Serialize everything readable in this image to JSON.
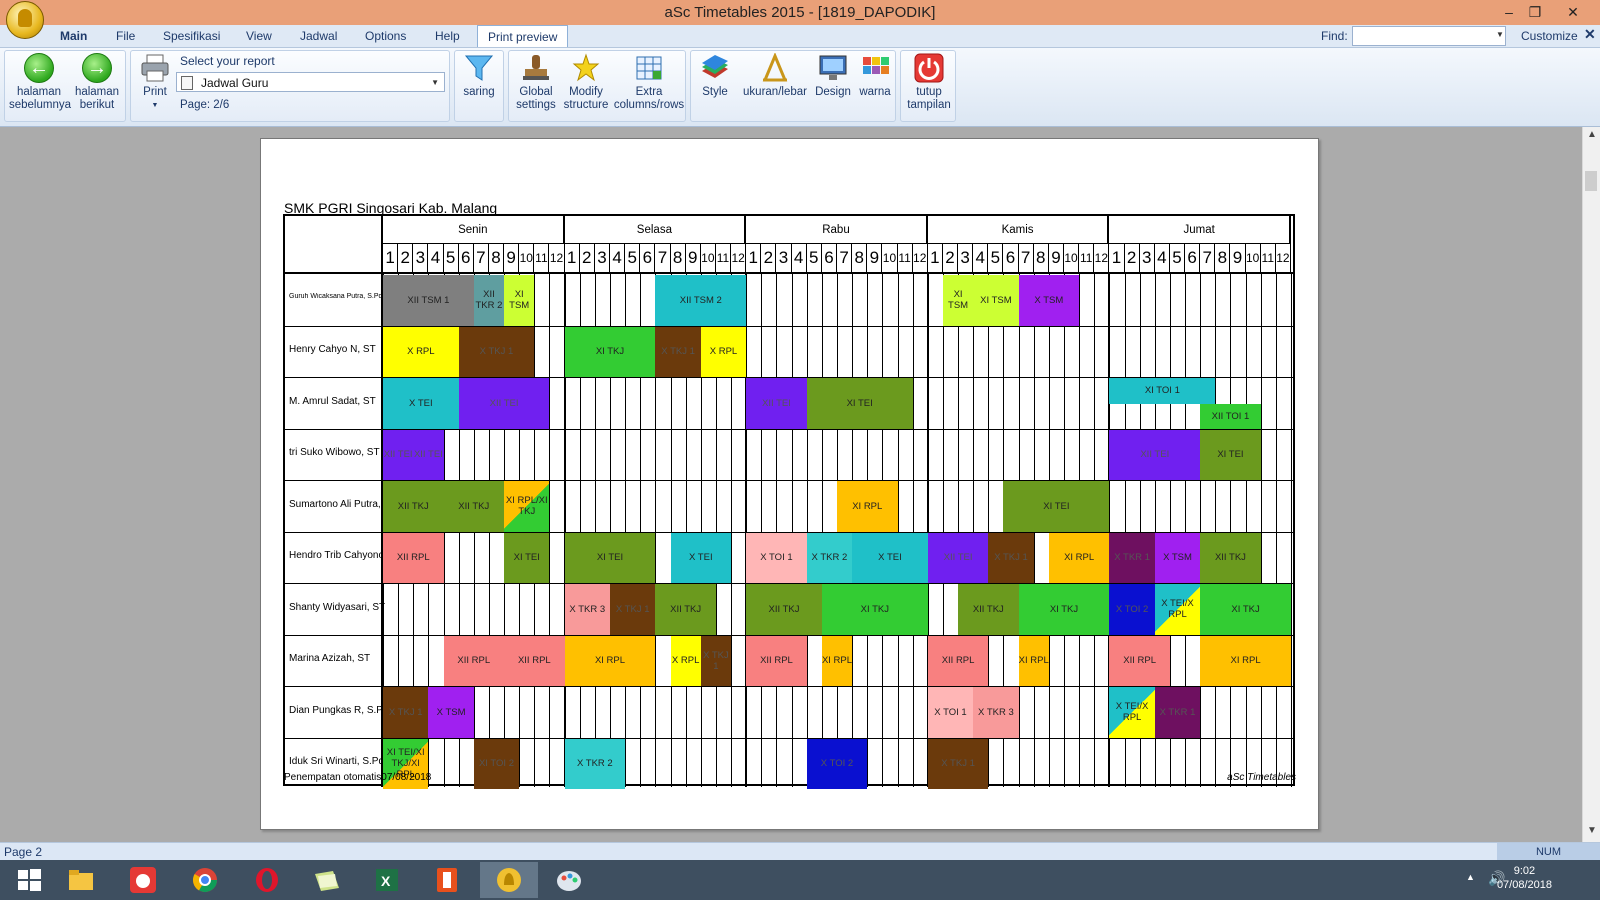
{
  "window": {
    "title": "aSc Timetables 2015  - [1819_DAPODIK]",
    "minimize": "–",
    "restore": "❐",
    "close": "✕"
  },
  "menu": {
    "items": [
      "Main",
      "File",
      "Spesifikasi",
      "View",
      "Jadwal",
      "Options",
      "Help"
    ],
    "active_tab": "Print preview",
    "find_label": "Find:",
    "find_value": "",
    "customize": "Customize",
    "close_glyph": "✕"
  },
  "ribbon": {
    "prev_label_1": "halaman",
    "prev_label_2": "sebelumnya",
    "next_label_1": "halaman",
    "next_label_2": "berikut",
    "print_label": "Print",
    "select_label": "Select your report",
    "report_value": "Jadwal Guru",
    "page_indicator": "Page: 2/6",
    "filter_label": "saring",
    "global_1": "Global",
    "global_2": "settings",
    "modify_1": "Modify",
    "modify_2": "structure",
    "extra_1": "Extra",
    "extra_2": "columns/rows",
    "style_label": "Style",
    "size_label": "ukuran/lebar",
    "design_label": "Design",
    "color_label": "warna",
    "close_1": "tutup",
    "close_2": "tampilan"
  },
  "timetable": {
    "school": "SMK PGRI Singosari Kab. Malang",
    "days": [
      "Senin",
      "Selasa",
      "Rabu",
      "Kamis",
      "Jumat"
    ],
    "periods": [
      "1",
      "2",
      "3",
      "4",
      "5",
      "6",
      "7",
      "8",
      "9",
      "10",
      "11",
      "12"
    ],
    "teachers": [
      "Guruh Wicaksana Putra, S.Pd",
      "Henry Cahyo N, ST",
      "M. Amrul Sadat, ST",
      "tri Suko Wibowo, ST",
      "Sumartono Ali Putra, ST",
      "Hendro Trib Cahyono, ST",
      "Shanty Widyasari, ST",
      "Marina Azizah, ST",
      "Dian Pungkas R, S.Pd",
      "Iduk Sri Winarti, S.Pd"
    ],
    "lessons": [
      {
        "row": 0,
        "day": 0,
        "p": 1,
        "span": 6,
        "label": "XII TSM 1",
        "color": "#7f7f7f"
      },
      {
        "row": 0,
        "day": 0,
        "p": 7,
        "span": 2,
        "label": "XII TKR 2",
        "color": "#5f9ea0"
      },
      {
        "row": 0,
        "day": 0,
        "p": 9,
        "span": 2,
        "label": "XI TSM",
        "color": "#ccff33"
      },
      {
        "row": 0,
        "day": 1,
        "p": 7,
        "span": 6,
        "label": "XII TSM 2",
        "color": "#1fc0c8"
      },
      {
        "row": 0,
        "day": 3,
        "p": 2,
        "span": 2,
        "label": "XI TSM",
        "color": "#ccff33"
      },
      {
        "row": 0,
        "day": 3,
        "p": 4,
        "span": 3,
        "label": "XI TSM",
        "color": "#ccff33"
      },
      {
        "row": 0,
        "day": 3,
        "p": 7,
        "span": 4,
        "label": "X TSM",
        "color": "#a020f0"
      },
      {
        "row": 1,
        "day": 0,
        "p": 1,
        "span": 5,
        "label": "X RPL",
        "color": "#ffff00"
      },
      {
        "row": 1,
        "day": 0,
        "p": 6,
        "span": 5,
        "label": "X TKJ 1",
        "color": "#6b3a0c"
      },
      {
        "row": 1,
        "day": 1,
        "p": 1,
        "span": 6,
        "label": "XI TKJ",
        "color": "#33cc33"
      },
      {
        "row": 1,
        "day": 1,
        "p": 7,
        "span": 3,
        "label": "X TKJ 1",
        "color": "#6b3a0c"
      },
      {
        "row": 1,
        "day": 1,
        "p": 10,
        "span": 3,
        "label": "X RPL",
        "color": "#ffff00"
      },
      {
        "row": 2,
        "day": 0,
        "p": 1,
        "span": 5,
        "label": "X TEI",
        "color": "#1fc0c8"
      },
      {
        "row": 2,
        "day": 0,
        "p": 6,
        "span": 6,
        "label": "XII TEI",
        "color": "#7020f0"
      },
      {
        "row": 2,
        "day": 2,
        "p": 1,
        "span": 4,
        "label": "XII TEI",
        "color": "#7020f0"
      },
      {
        "row": 2,
        "day": 2,
        "p": 5,
        "span": 7,
        "label": "XI TEI",
        "color": "#6b9a1e"
      },
      {
        "row": 2,
        "day": 4,
        "p": 1,
        "span": 7,
        "label": "XI TOI 1",
        "color": "#1fc0c8",
        "half": "top"
      },
      {
        "row": 2,
        "day": 4,
        "p": 7,
        "span": 4,
        "label": "XII TOI 1",
        "color": "#33cc33",
        "half": "bottom"
      },
      {
        "row": 3,
        "day": 0,
        "p": 1,
        "span": 2,
        "label": "XII TEI",
        "color": "#7020f0"
      },
      {
        "row": 3,
        "day": 0,
        "p": 3,
        "span": 2,
        "label": "XII TEI",
        "color": "#7020f0"
      },
      {
        "row": 3,
        "day": 4,
        "p": 1,
        "span": 6,
        "label": "XII TEI",
        "color": "#7020f0"
      },
      {
        "row": 3,
        "day": 4,
        "p": 7,
        "span": 4,
        "label": "XI TEI",
        "color": "#6b9a1e"
      },
      {
        "row": 4,
        "day": 0,
        "p": 1,
        "span": 4,
        "label": "XII TKJ",
        "color": "#6b9a1e"
      },
      {
        "row": 4,
        "day": 0,
        "p": 5,
        "span": 4,
        "label": "XII TKJ",
        "color": "#6b9a1e"
      },
      {
        "row": 4,
        "day": 0,
        "p": 9,
        "span": 3,
        "label": "XI RPL/XI TKJ",
        "color": "#ffc000",
        "color2": "#33cc33"
      },
      {
        "row": 4,
        "day": 2,
        "p": 7,
        "span": 4,
        "label": "XI RPL",
        "color": "#ffc000"
      },
      {
        "row": 4,
        "day": 3,
        "p": 6,
        "span": 7,
        "label": "XI TEI",
        "color": "#6b9a1e"
      },
      {
        "row": 5,
        "day": 0,
        "p": 1,
        "span": 4,
        "label": "XII RPL",
        "color": "#f88080"
      },
      {
        "row": 5,
        "day": 0,
        "p": 9,
        "span": 3,
        "label": "XI TEI",
        "color": "#6b9a1e"
      },
      {
        "row": 5,
        "day": 1,
        "p": 1,
        "span": 6,
        "label": "XI TEI",
        "color": "#6b9a1e"
      },
      {
        "row": 5,
        "day": 1,
        "p": 8,
        "span": 4,
        "label": "X TEI",
        "color": "#1fc0c8"
      },
      {
        "row": 5,
        "day": 2,
        "p": 1,
        "span": 4,
        "label": "X TOI 1",
        "color": "#ffb6b6"
      },
      {
        "row": 5,
        "day": 2,
        "p": 5,
        "span": 3,
        "label": "X TKR 2",
        "color": "#33cccc"
      },
      {
        "row": 5,
        "day": 2,
        "p": 8,
        "span": 5,
        "label": "X TEI",
        "color": "#1fc0c8"
      },
      {
        "row": 5,
        "day": 3,
        "p": 1,
        "span": 4,
        "label": "XII TEI",
        "color": "#7020f0"
      },
      {
        "row": 5,
        "day": 3,
        "p": 5,
        "span": 3,
        "label": "X TKJ 1",
        "color": "#6b3a0c"
      },
      {
        "row": 5,
        "day": 3,
        "p": 9,
        "span": 4,
        "label": "XI RPL",
        "color": "#ffc000"
      },
      {
        "row": 5,
        "day": 4,
        "p": 1,
        "span": 3,
        "label": "X TKR 1",
        "color": "#6e1060"
      },
      {
        "row": 5,
        "day": 4,
        "p": 4,
        "span": 3,
        "label": "X TSM",
        "color": "#a020f0"
      },
      {
        "row": 5,
        "day": 4,
        "p": 7,
        "span": 4,
        "label": "XII TKJ",
        "color": "#6b9a1e"
      },
      {
        "row": 6,
        "day": 1,
        "p": 1,
        "span": 3,
        "label": "X TKR 3",
        "color": "#f89a9a"
      },
      {
        "row": 6,
        "day": 1,
        "p": 4,
        "span": 3,
        "label": "X TKJ 1",
        "color": "#6b3a0c"
      },
      {
        "row": 6,
        "day": 1,
        "p": 7,
        "span": 4,
        "label": "XII TKJ",
        "color": "#6b9a1e"
      },
      {
        "row": 6,
        "day": 2,
        "p": 1,
        "span": 5,
        "label": "XII TKJ",
        "color": "#6b9a1e"
      },
      {
        "row": 6,
        "day": 2,
        "p": 6,
        "span": 7,
        "label": "XI TKJ",
        "color": "#33cc33"
      },
      {
        "row": 6,
        "day": 3,
        "p": 3,
        "span": 4,
        "label": "XII TKJ",
        "color": "#6b9a1e"
      },
      {
        "row": 6,
        "day": 3,
        "p": 7,
        "span": 6,
        "label": "XI TKJ",
        "color": "#33cc33"
      },
      {
        "row": 6,
        "day": 4,
        "p": 1,
        "span": 3,
        "label": "X TOI 2",
        "color": "#0a10d0"
      },
      {
        "row": 6,
        "day": 4,
        "p": 4,
        "span": 3,
        "label": "X TEI/X RPL",
        "color": "#1fc0c8",
        "color2": "#ffff00"
      },
      {
        "row": 6,
        "day": 4,
        "p": 7,
        "span": 6,
        "label": "XI TKJ",
        "color": "#33cc33"
      },
      {
        "row": 7,
        "day": 0,
        "p": 5,
        "span": 4,
        "label": "XII RPL",
        "color": "#f88080"
      },
      {
        "row": 7,
        "day": 0,
        "p": 9,
        "span": 4,
        "label": "XII RPL",
        "color": "#f88080"
      },
      {
        "row": 7,
        "day": 1,
        "p": 1,
        "span": 6,
        "label": "XI RPL",
        "color": "#ffc000"
      },
      {
        "row": 7,
        "day": 1,
        "p": 8,
        "span": 2,
        "label": "X RPL",
        "color": "#ffff00"
      },
      {
        "row": 7,
        "day": 1,
        "p": 10,
        "span": 2,
        "label": "X TKJ 1",
        "color": "#6b3a0c"
      },
      {
        "row": 7,
        "day": 2,
        "p": 1,
        "span": 4,
        "label": "XII RPL",
        "color": "#f88080"
      },
      {
        "row": 7,
        "day": 2,
        "p": 6,
        "span": 2,
        "label": "XI RPL",
        "color": "#ffc000"
      },
      {
        "row": 7,
        "day": 3,
        "p": 1,
        "span": 4,
        "label": "XII RPL",
        "color": "#f88080"
      },
      {
        "row": 7,
        "day": 3,
        "p": 7,
        "span": 2,
        "label": "XI RPL",
        "color": "#ffc000"
      },
      {
        "row": 7,
        "day": 4,
        "p": 1,
        "span": 4,
        "label": "XII RPL",
        "color": "#f88080"
      },
      {
        "row": 7,
        "day": 4,
        "p": 7,
        "span": 6,
        "label": "XI RPL",
        "color": "#ffc000"
      },
      {
        "row": 8,
        "day": 0,
        "p": 1,
        "span": 3,
        "label": "X TKJ 1",
        "color": "#6b3a0c"
      },
      {
        "row": 8,
        "day": 0,
        "p": 4,
        "span": 3,
        "label": "X TSM",
        "color": "#a020f0"
      },
      {
        "row": 8,
        "day": 3,
        "p": 1,
        "span": 3,
        "label": "X TOI 1",
        "color": "#ffb6b6"
      },
      {
        "row": 8,
        "day": 3,
        "p": 4,
        "span": 3,
        "label": "X TKR 3",
        "color": "#f89a9a"
      },
      {
        "row": 8,
        "day": 4,
        "p": 1,
        "span": 3,
        "label": "X TEI/X RPL",
        "color": "#1fc0c8",
        "color2": "#ffff00"
      },
      {
        "row": 8,
        "day": 4,
        "p": 4,
        "span": 3,
        "label": "X TKR 1",
        "color": "#6e1060"
      },
      {
        "row": 9,
        "day": 0,
        "p": 1,
        "span": 3,
        "label": "XI TEI/XI TKJ/XI RPL",
        "color": "#33cc33",
        "color2": "#ffc000"
      },
      {
        "row": 9,
        "day": 0,
        "p": 7,
        "span": 3,
        "label": "XI TOI 2",
        "color": "#6b3a0c"
      },
      {
        "row": 9,
        "day": 1,
        "p": 1,
        "span": 4,
        "label": "X TKR 2",
        "color": "#33cccc"
      },
      {
        "row": 9,
        "day": 2,
        "p": 5,
        "span": 4,
        "label": "X TOI 2",
        "color": "#0a10d0"
      },
      {
        "row": 9,
        "day": 3,
        "p": 1,
        "span": 4,
        "label": "X TKJ 1",
        "color": "#6b3a0c"
      }
    ],
    "footer_left": "Penempatan otomatis07/08/2018",
    "footer_right": "aSc Timetables"
  },
  "status": {
    "page": "Page 2",
    "num": "NUM"
  },
  "taskbar": {
    "apps": [
      "start",
      "explorer",
      "cat",
      "chrome",
      "opera",
      "folder",
      "excel",
      "office",
      "asc",
      "paint"
    ],
    "active_app": "asc",
    "time": "9:02",
    "date": "07/08/2018"
  }
}
